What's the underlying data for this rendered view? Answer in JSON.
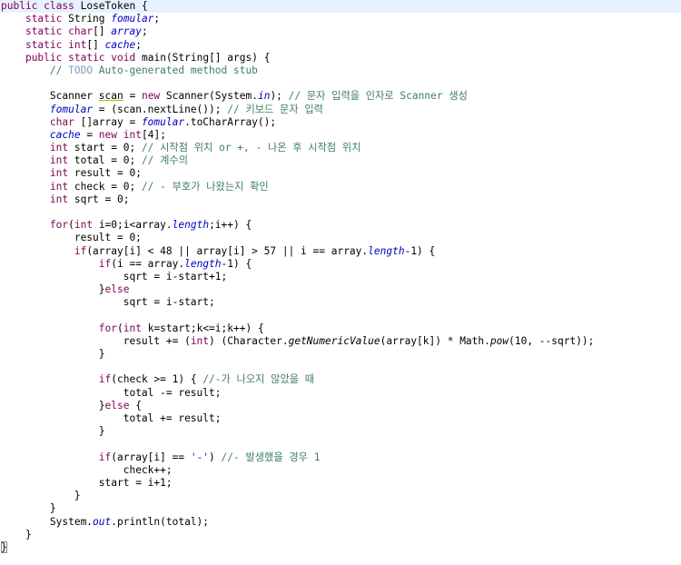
{
  "editor": {
    "lines": [
      {
        "indent": 0,
        "tokens": [
          {
            "t": "kw",
            "v": "public"
          },
          {
            "t": "p",
            "v": " "
          },
          {
            "t": "kw",
            "v": "class"
          },
          {
            "t": "p",
            "v": " LoseToken {"
          }
        ]
      },
      {
        "indent": 1,
        "tokens": [
          {
            "t": "kw",
            "v": "static"
          },
          {
            "t": "p",
            "v": " String "
          },
          {
            "t": "field",
            "v": "fomular"
          },
          {
            "t": "p",
            "v": ";"
          }
        ]
      },
      {
        "indent": 1,
        "tokens": [
          {
            "t": "kw",
            "v": "static"
          },
          {
            "t": "p",
            "v": " "
          },
          {
            "t": "kw",
            "v": "char"
          },
          {
            "t": "p",
            "v": "[] "
          },
          {
            "t": "field",
            "v": "array"
          },
          {
            "t": "p",
            "v": ";"
          }
        ]
      },
      {
        "indent": 1,
        "tokens": [
          {
            "t": "kw",
            "v": "static"
          },
          {
            "t": "p",
            "v": " "
          },
          {
            "t": "kw",
            "v": "int"
          },
          {
            "t": "p",
            "v": "[] "
          },
          {
            "t": "field",
            "v": "cache"
          },
          {
            "t": "p",
            "v": ";"
          }
        ]
      },
      {
        "indent": 1,
        "tokens": [
          {
            "t": "kw",
            "v": "public"
          },
          {
            "t": "p",
            "v": " "
          },
          {
            "t": "kw",
            "v": "static"
          },
          {
            "t": "p",
            "v": " "
          },
          {
            "t": "kw",
            "v": "void"
          },
          {
            "t": "p",
            "v": " main(String[] args) {"
          }
        ]
      },
      {
        "indent": 2,
        "tokens": [
          {
            "t": "cmt",
            "v": "// "
          },
          {
            "t": "todo",
            "v": "TODO"
          },
          {
            "t": "cmt",
            "v": " Auto-generated method stub"
          }
        ]
      },
      {
        "indent": 0,
        "tokens": []
      },
      {
        "indent": 2,
        "tokens": [
          {
            "t": "p",
            "v": "Scanner "
          },
          {
            "t": "warn",
            "v": "scan"
          },
          {
            "t": "p",
            "v": " = "
          },
          {
            "t": "kw",
            "v": "new"
          },
          {
            "t": "p",
            "v": " Scanner(System."
          },
          {
            "t": "field",
            "v": "in"
          },
          {
            "t": "p",
            "v": "); "
          },
          {
            "t": "cmt",
            "v": "// 문자 입력을 인자로 Scanner 생성"
          }
        ]
      },
      {
        "indent": 2,
        "tokens": [
          {
            "t": "field",
            "v": "fomular"
          },
          {
            "t": "p",
            "v": " = (scan.nextLine()); "
          },
          {
            "t": "cmt",
            "v": "// 키보드 문자 입력"
          }
        ]
      },
      {
        "indent": 2,
        "tokens": [
          {
            "t": "kw",
            "v": "char"
          },
          {
            "t": "p",
            "v": " []array = "
          },
          {
            "t": "field",
            "v": "fomular"
          },
          {
            "t": "p",
            "v": ".toCharArray();"
          }
        ]
      },
      {
        "indent": 2,
        "tokens": [
          {
            "t": "field",
            "v": "cache"
          },
          {
            "t": "p",
            "v": " = "
          },
          {
            "t": "kw",
            "v": "new"
          },
          {
            "t": "p",
            "v": " "
          },
          {
            "t": "kw",
            "v": "int"
          },
          {
            "t": "p",
            "v": "[4];"
          }
        ]
      },
      {
        "indent": 2,
        "tokens": [
          {
            "t": "kw",
            "v": "int"
          },
          {
            "t": "p",
            "v": " start = 0; "
          },
          {
            "t": "cmt",
            "v": "// 시작점 위치 or +, - 나온 후 시작점 위치"
          }
        ]
      },
      {
        "indent": 2,
        "tokens": [
          {
            "t": "kw",
            "v": "int"
          },
          {
            "t": "p",
            "v": " total = 0; "
          },
          {
            "t": "cmt",
            "v": "// 계수의"
          }
        ]
      },
      {
        "indent": 2,
        "tokens": [
          {
            "t": "kw",
            "v": "int"
          },
          {
            "t": "p",
            "v": " result = 0;"
          }
        ]
      },
      {
        "indent": 2,
        "tokens": [
          {
            "t": "kw",
            "v": "int"
          },
          {
            "t": "p",
            "v": " check = 0; "
          },
          {
            "t": "cmt",
            "v": "// - 부호가 나왔는지 확인"
          }
        ]
      },
      {
        "indent": 2,
        "tokens": [
          {
            "t": "kw",
            "v": "int"
          },
          {
            "t": "p",
            "v": " sqrt = 0;"
          }
        ]
      },
      {
        "indent": 0,
        "tokens": []
      },
      {
        "indent": 2,
        "tokens": [
          {
            "t": "kw",
            "v": "for"
          },
          {
            "t": "p",
            "v": "("
          },
          {
            "t": "kw",
            "v": "int"
          },
          {
            "t": "p",
            "v": " i=0;i<array."
          },
          {
            "t": "field",
            "v": "length"
          },
          {
            "t": "p",
            "v": ";i++) {"
          }
        ]
      },
      {
        "indent": 3,
        "tokens": [
          {
            "t": "p",
            "v": "result = 0;"
          }
        ]
      },
      {
        "indent": 3,
        "tokens": [
          {
            "t": "kw",
            "v": "if"
          },
          {
            "t": "p",
            "v": "(array[i] < 48 || array[i] > 57 || i == array."
          },
          {
            "t": "field",
            "v": "length"
          },
          {
            "t": "p",
            "v": "-1) {"
          }
        ]
      },
      {
        "indent": 4,
        "tokens": [
          {
            "t": "kw",
            "v": "if"
          },
          {
            "t": "p",
            "v": "(i == array."
          },
          {
            "t": "field",
            "v": "length"
          },
          {
            "t": "p",
            "v": "-1) {"
          }
        ]
      },
      {
        "indent": 5,
        "tokens": [
          {
            "t": "p",
            "v": "sqrt = i-start+1;"
          }
        ]
      },
      {
        "indent": 4,
        "tokens": [
          {
            "t": "p",
            "v": "}"
          },
          {
            "t": "kw",
            "v": "else"
          }
        ]
      },
      {
        "indent": 5,
        "tokens": [
          {
            "t": "p",
            "v": "sqrt = i-start;"
          }
        ]
      },
      {
        "indent": 0,
        "tokens": []
      },
      {
        "indent": 4,
        "tokens": [
          {
            "t": "kw",
            "v": "for"
          },
          {
            "t": "p",
            "v": "("
          },
          {
            "t": "kw",
            "v": "int"
          },
          {
            "t": "p",
            "v": " k=start;k<=i;k++) {"
          }
        ]
      },
      {
        "indent": 5,
        "tokens": [
          {
            "t": "p",
            "v": "result += ("
          },
          {
            "t": "kw",
            "v": "int"
          },
          {
            "t": "p",
            "v": ") (Character."
          },
          {
            "t": "sm",
            "v": "getNumericValue"
          },
          {
            "t": "p",
            "v": "(array[k]) * Math."
          },
          {
            "t": "sm",
            "v": "pow"
          },
          {
            "t": "p",
            "v": "(10, --sqrt));"
          }
        ]
      },
      {
        "indent": 4,
        "tokens": [
          {
            "t": "p",
            "v": "}"
          }
        ]
      },
      {
        "indent": 0,
        "tokens": []
      },
      {
        "indent": 4,
        "tokens": [
          {
            "t": "kw",
            "v": "if"
          },
          {
            "t": "p",
            "v": "(check >= 1) { "
          },
          {
            "t": "cmt",
            "v": "//-가 나오지 않았을 때"
          }
        ]
      },
      {
        "indent": 5,
        "tokens": [
          {
            "t": "p",
            "v": "total -= result;"
          }
        ]
      },
      {
        "indent": 4,
        "tokens": [
          {
            "t": "p",
            "v": "}"
          },
          {
            "t": "kw",
            "v": "else"
          },
          {
            "t": "p",
            "v": " {"
          }
        ]
      },
      {
        "indent": 5,
        "tokens": [
          {
            "t": "p",
            "v": "total += result;"
          }
        ]
      },
      {
        "indent": 4,
        "tokens": [
          {
            "t": "p",
            "v": "}"
          }
        ]
      },
      {
        "indent": 0,
        "tokens": []
      },
      {
        "indent": 4,
        "tokens": [
          {
            "t": "kw",
            "v": "if"
          },
          {
            "t": "p",
            "v": "(array[i] == "
          },
          {
            "t": "str",
            "v": "'-'"
          },
          {
            "t": "p",
            "v": ") "
          },
          {
            "t": "cmt",
            "v": "//- 발생했을 경우 1"
          }
        ]
      },
      {
        "indent": 5,
        "tokens": [
          {
            "t": "p",
            "v": "check++;"
          }
        ]
      },
      {
        "indent": 4,
        "tokens": [
          {
            "t": "p",
            "v": "start = i+1;"
          }
        ]
      },
      {
        "indent": 3,
        "tokens": [
          {
            "t": "p",
            "v": "}"
          }
        ]
      },
      {
        "indent": 2,
        "tokens": [
          {
            "t": "p",
            "v": "}"
          }
        ]
      },
      {
        "indent": 2,
        "tokens": [
          {
            "t": "p",
            "v": "System."
          },
          {
            "t": "field",
            "v": "out"
          },
          {
            "t": "p",
            "v": ".println(total);"
          }
        ]
      },
      {
        "indent": 1,
        "tokens": [
          {
            "t": "p",
            "v": "}"
          }
        ]
      },
      {
        "indent": 0,
        "tokens": [
          {
            "t": "brace",
            "v": "}"
          }
        ]
      }
    ]
  }
}
